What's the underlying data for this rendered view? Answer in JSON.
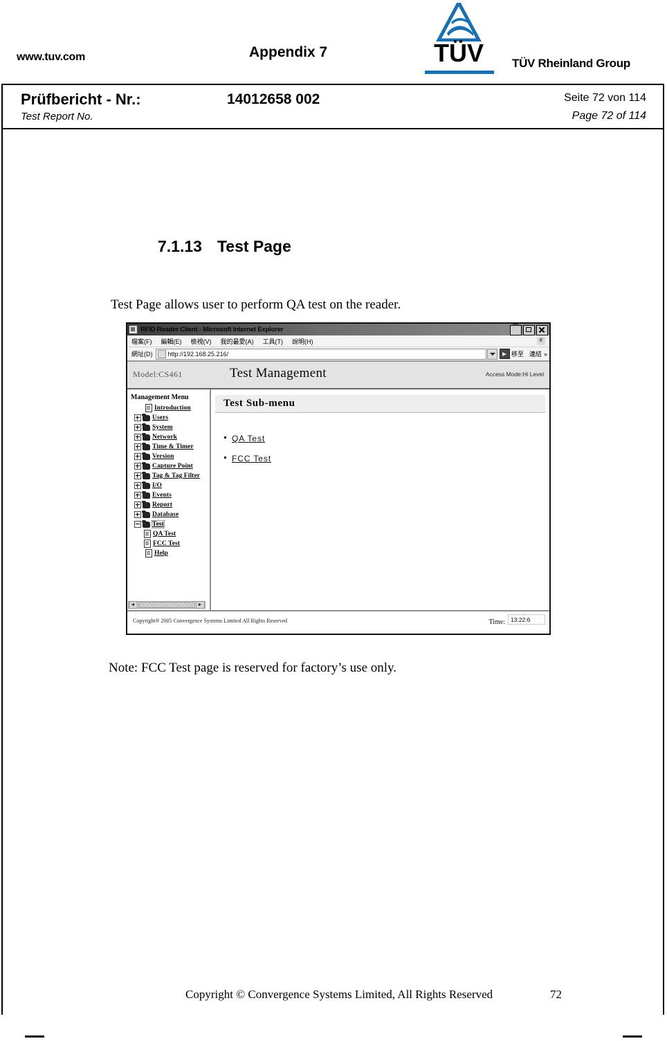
{
  "header": {
    "site_url": "www.tuv.com",
    "appendix": "Appendix 7",
    "logo_word": "TÜV",
    "group_name": "TÜV Rheinland Group"
  },
  "report_bar": {
    "pruefbericht_label": "Prüfbericht - Nr.:",
    "test_report_label": "Test Report No.",
    "report_number": "14012658 002",
    "seite_de": "Seite 72 von 114",
    "page_en": "Page 72 of 114"
  },
  "section": {
    "number": "7.1.13",
    "title": "Test Page",
    "intro": "Test Page allows user to perform QA test on the reader.",
    "note": "Note: FCC Test page is reserved for factory’s use only."
  },
  "browser": {
    "window_title": "RFID Reader Client - Microsoft Internet Explorer",
    "window_buttons": {
      "minimize": "–",
      "maximize": "□",
      "close": "✕"
    },
    "menu_items": [
      "檔案(F)",
      "編輯(E)",
      "檢視(V)",
      "我的最愛(A)",
      "工具(T)",
      "說明(H)"
    ],
    "address": {
      "label": "網址(D)",
      "url": "http://192.168.25.216/",
      "go_label": "移至",
      "links_label": "連結",
      "chevron": "»"
    }
  },
  "app": {
    "model": "Model:CS461",
    "page_title": "Test Management",
    "access_mode": "Access Mode:Hi Level",
    "sidebar": {
      "title": "Management Menu",
      "items": [
        {
          "label": "Introduction",
          "icon": "page-icon",
          "expander": "none",
          "indent": 1,
          "selected": false
        },
        {
          "label": "Users",
          "icon": "folder-icon",
          "expander": "plus",
          "indent": 0,
          "selected": false
        },
        {
          "label": "System",
          "icon": "folder-icon",
          "expander": "plus",
          "indent": 0,
          "selected": false
        },
        {
          "label": "Network",
          "icon": "folder-icon",
          "expander": "plus",
          "indent": 0,
          "selected": false
        },
        {
          "label": "Time & Timer",
          "icon": "folder-icon",
          "expander": "plus",
          "indent": 0,
          "selected": false
        },
        {
          "label": "Version",
          "icon": "folder-icon",
          "expander": "plus",
          "indent": 0,
          "selected": false
        },
        {
          "label": "Capture Point",
          "icon": "folder-icon",
          "expander": "plus",
          "indent": 0,
          "selected": false
        },
        {
          "label": "Tag & Tag Filter",
          "icon": "folder-icon",
          "expander": "plus",
          "indent": 0,
          "selected": false
        },
        {
          "label": "I/O",
          "icon": "folder-icon",
          "expander": "plus",
          "indent": 0,
          "selected": false
        },
        {
          "label": "Events",
          "icon": "folder-icon",
          "expander": "plus",
          "indent": 0,
          "selected": false
        },
        {
          "label": "Report",
          "icon": "folder-icon",
          "expander": "plus",
          "indent": 0,
          "selected": false
        },
        {
          "label": "Database",
          "icon": "folder-icon",
          "expander": "plus",
          "indent": 0,
          "selected": false
        },
        {
          "label": "Test",
          "icon": "folder-open-icon",
          "expander": "minus",
          "indent": 0,
          "selected": true
        },
        {
          "label": "QA Test",
          "icon": "page-icon",
          "expander": "none",
          "indent": 2,
          "selected": false
        },
        {
          "label": "FCC Test",
          "icon": "page-icon",
          "expander": "none",
          "indent": 2,
          "selected": false
        },
        {
          "label": "Help",
          "icon": "page-icon",
          "expander": "none",
          "indent": 1,
          "selected": false
        }
      ]
    },
    "content": {
      "submenu_title": "Test  Sub-menu",
      "links": [
        "QA  Test",
        "FCC  Test"
      ]
    },
    "footer": {
      "copyright": "Copyright® 2005 Convergence Systems Limited  All Rights Reserved",
      "time_label": "Time:",
      "time_value": "13:22:6"
    }
  },
  "page_footer": {
    "copyright": "Copyright © Convergence Systems Limited, All Rights Reserved",
    "page_number": "72"
  }
}
